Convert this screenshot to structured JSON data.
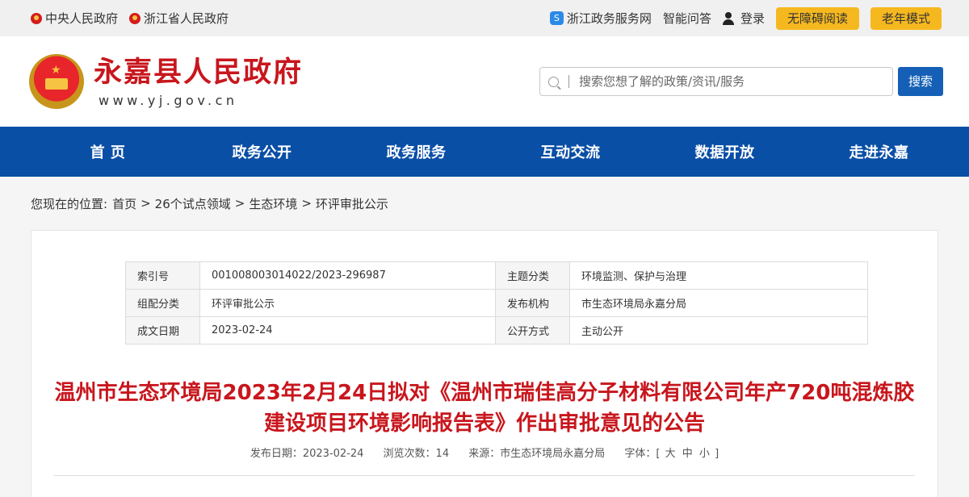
{
  "topbar": {
    "links": [
      "中央人民政府",
      "浙江省人民政府"
    ],
    "zwfw": "浙江政务服务网",
    "qa": "智能问答",
    "login": "登录",
    "accessible": "无障碍阅读",
    "elder": "老年模式"
  },
  "header": {
    "site_name": "永嘉县人民政府",
    "site_url": "www.yj.gov.cn",
    "search_placeholder": "搜索您想了解的政策/资讯/服务",
    "search_button": "搜索"
  },
  "nav": [
    "首 页",
    "政务公开",
    "政务服务",
    "互动交流",
    "数据开放",
    "走进永嘉"
  ],
  "breadcrumb": {
    "label": "您现在的位置:",
    "items": [
      "首页",
      "26个试点领域",
      "生态环境",
      "环评审批公示"
    ],
    "sep": ">"
  },
  "meta": [
    {
      "k1": "索引号",
      "v1": "001008003014022/2023-296987",
      "k2": "主题分类",
      "v2": "环境监测、保护与治理"
    },
    {
      "k1": "组配分类",
      "v1": "环评审批公示",
      "k2": "发布机构",
      "v2": "市生态环境局永嘉分局"
    },
    {
      "k1": "成文日期",
      "v1": "2023-02-24",
      "k2": "公开方式",
      "v2": "主动公开"
    }
  ],
  "article": {
    "title": "温州市生态环境局2023年2月24日拟对《温州市瑞佳高分子材料有限公司年产720吨混炼胶建设项目环境影响报告表》作出审批意见的公告",
    "publish_date": "发布日期：2023-02-24",
    "views": "浏览次数：14",
    "source": "来源：市生态环境局永嘉分局",
    "font_label": "字体：[",
    "font_large": "大",
    "font_medium": "中",
    "font_small": "小",
    "font_close": "]"
  }
}
